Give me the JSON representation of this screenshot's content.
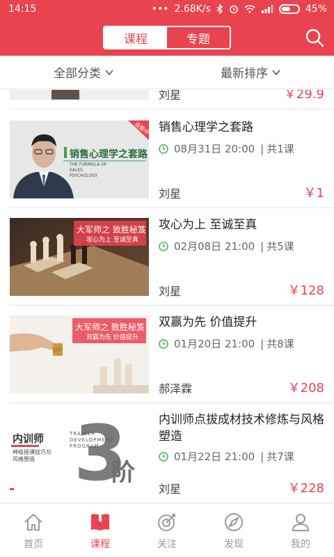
{
  "status_bar": {
    "time": "14:15",
    "network_speed": "2.68K/s",
    "battery": "45%"
  },
  "header": {
    "tabs": [
      {
        "label": "课程",
        "active": true
      },
      {
        "label": "专题",
        "active": false
      }
    ],
    "accent_color": "#e9434f"
  },
  "filters": {
    "category": "全部分类",
    "sort": "最新排序"
  },
  "list": {
    "partial_top": {
      "author": "刘星",
      "price": "￥29.9"
    },
    "items": [
      {
        "title": "销售心理学之套路",
        "date": "08月31日 20:00",
        "lessons": "共1课",
        "author": "刘星",
        "price": "￥1",
        "thumb": {
          "headline": "销售心理学之套路",
          "sub": "THE FORMULA OF SALES PSYCHOLOGY",
          "badge": "连载中"
        }
      },
      {
        "title": "攻心为上 至诚至真",
        "date": "02月08日 21:00",
        "lessons": "共5课",
        "author": "刘星",
        "price": "￥128",
        "thumb": {
          "headline": "大军师之 致胜秘笈",
          "sub": "攻心为上 至诚至真"
        }
      },
      {
        "title": "双赢为先 价值提升",
        "date": "01月20日 21:00",
        "lessons": "共8课",
        "author": "郝泽霖",
        "price": "￥208",
        "thumb": {
          "headline": "大军师之 致胜秘笈",
          "sub": "双赢为先 价值提升"
        }
      },
      {
        "title": "内训师点拔成材技术修炼与风格塑造",
        "date": "01月22日 21:00",
        "lessons": "共7课",
        "author": "刘星",
        "price": "￥228",
        "thumb": {
          "headline": "内训师",
          "sub": "神级授课技巧与风格塑造",
          "en": "TRAINER DEVELOPMENT PROGRAM",
          "big": "3阶"
        }
      }
    ],
    "meta_sep": "|"
  },
  "bottom_nav": [
    {
      "label": "首页",
      "icon": "home-icon",
      "active": false
    },
    {
      "label": "课程",
      "icon": "book-icon",
      "active": true
    },
    {
      "label": "关注",
      "icon": "follow-icon",
      "active": false
    },
    {
      "label": "发现",
      "icon": "discover-icon",
      "active": false
    },
    {
      "label": "我的",
      "icon": "profile-icon",
      "active": false
    }
  ]
}
